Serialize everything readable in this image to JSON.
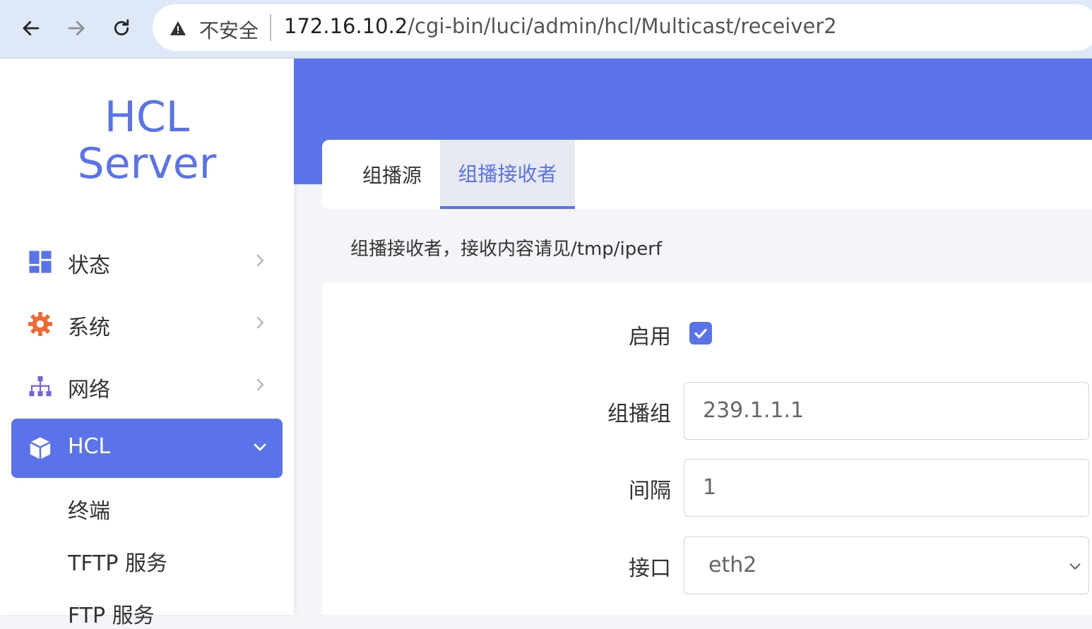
{
  "browser": {
    "security_label": "不安全",
    "url_host": "172.16.10.2",
    "url_path": "/cgi-bin/luci/admin/hcl/Multicast/receiver2"
  },
  "sidebar": {
    "logo_line1": "HCL",
    "logo_line2": "Server",
    "items": [
      {
        "label": "状态",
        "icon": "dashboard-icon"
      },
      {
        "label": "系统",
        "icon": "gear-icon"
      },
      {
        "label": "网络",
        "icon": "network-icon"
      },
      {
        "label": "HCL",
        "icon": "cube-icon"
      }
    ],
    "sub_items": [
      {
        "label": "终端"
      },
      {
        "label": "TFTP 服务"
      },
      {
        "label": "FTP 服务"
      }
    ]
  },
  "tabs": [
    {
      "label": "组播源"
    },
    {
      "label": "组播接收者"
    }
  ],
  "description": "组播接收者，接收内容请见/tmp/iperf",
  "form": {
    "enable_label": "启用",
    "enable_checked": true,
    "group_label": "组播组",
    "group_value": "239.1.1.1",
    "interval_label": "间隔",
    "interval_value": "1",
    "interface_label": "接口",
    "interface_value": "eth2"
  },
  "colors": {
    "accent": "#5b73e8",
    "gear": "#f06a35"
  }
}
